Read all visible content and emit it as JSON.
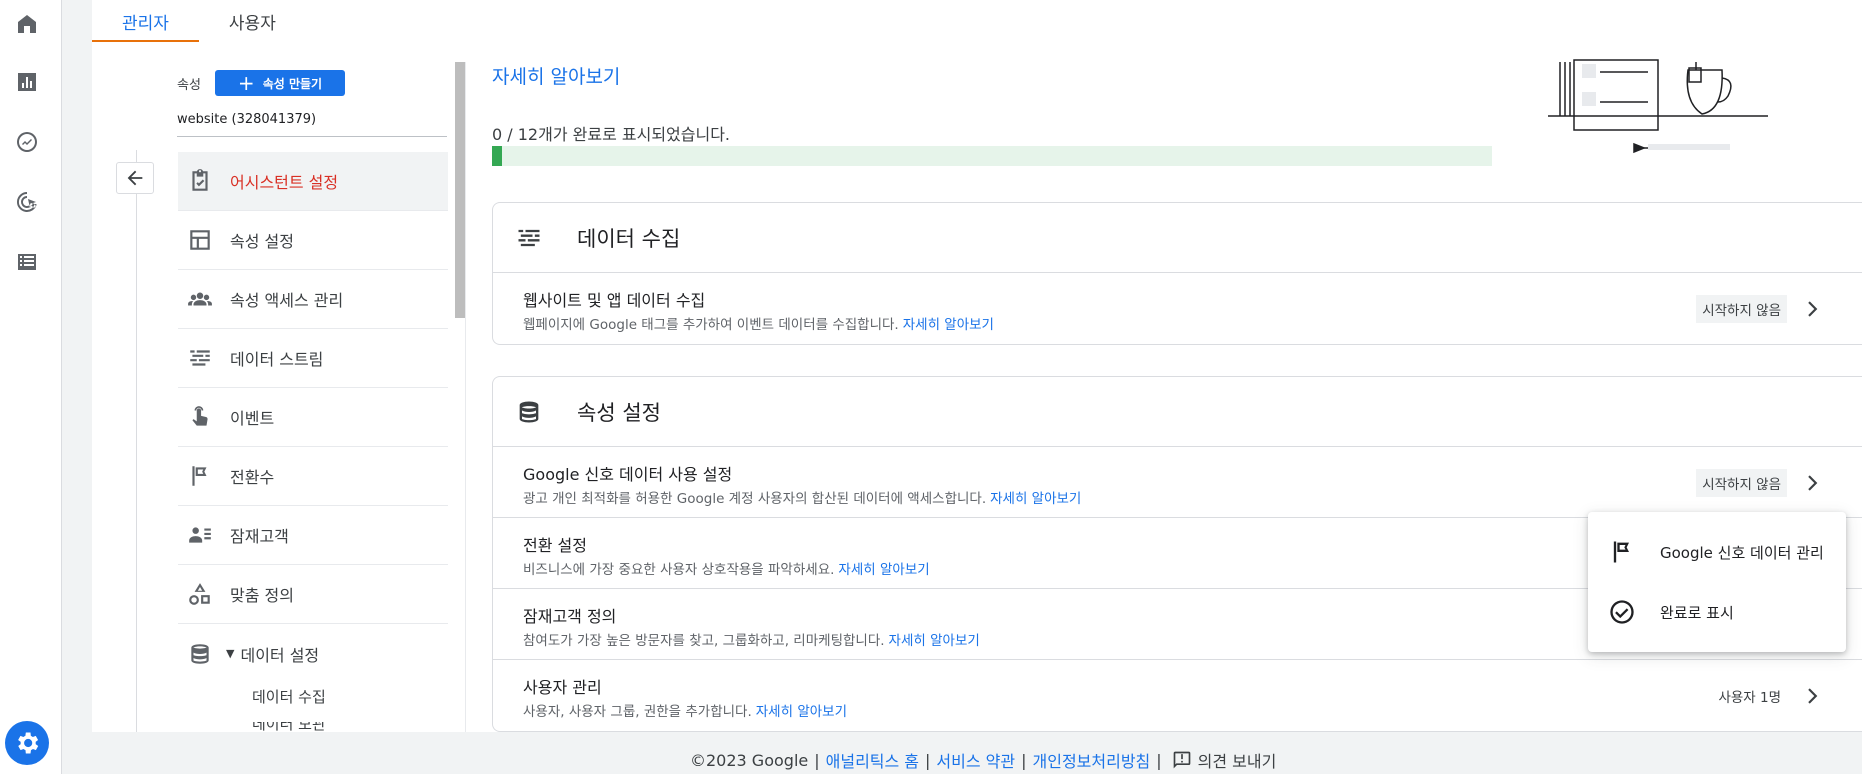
{
  "tabs": [
    {
      "label": "관리자"
    },
    {
      "label": "사용자"
    }
  ],
  "property": {
    "label": "속성",
    "create_label": "속성 만들기",
    "name": "website (328041379)"
  },
  "nav": {
    "items": [
      {
        "label": "어시스턴트 설정",
        "icon": "checklist-icon"
      },
      {
        "label": "속성 설정",
        "icon": "layout-icon"
      },
      {
        "label": "속성 액세스 관리",
        "icon": "people-icon"
      },
      {
        "label": "데이터 스트림",
        "icon": "streams-icon"
      },
      {
        "label": "이벤트",
        "icon": "touch-icon"
      },
      {
        "label": "전환수",
        "icon": "flag-icon"
      },
      {
        "label": "잠재고객",
        "icon": "audience-icon"
      },
      {
        "label": "맞춤 정의",
        "icon": "shapes-icon"
      },
      {
        "label": "데이터 설정",
        "icon": "database-icon"
      }
    ],
    "sub_items": [
      {
        "label": "데이터 수집"
      },
      {
        "label": "데이터 보관"
      }
    ]
  },
  "content": {
    "learn_more_top": "자세히 알아보기",
    "progress_text": "0 / 12개가 완료로 표시되었습니다.",
    "progress_fraction": 0.01
  },
  "cards": [
    {
      "title": "데이터 수집",
      "icon": "streams-icon",
      "rows": [
        {
          "title": "웹사이트 및 앱 데이터 수집",
          "desc": "웹페이지에 Google 태그를 추가하여 이벤트 데이터를 수집합니다.",
          "link": "자세히 알아보기",
          "status": "시작하지 않음"
        }
      ]
    },
    {
      "title": "속성 설정",
      "icon": "database-icon",
      "rows": [
        {
          "title": "Google 신호 데이터 사용 설정",
          "desc": "광고 개인 최적화를 허용한 Google 계정 사용자의 합산된 데이터에 액세스합니다.",
          "link": "자세히 알아보기",
          "status": "시작하지 않음"
        },
        {
          "title": "전환 설정",
          "desc": "비즈니스에 가장 중요한 사용자 상호작용을 파악하세요.",
          "link": "자세히 알아보기",
          "status": ""
        },
        {
          "title": "잠재고객 정의",
          "desc": "참여도가 가장 높은 방문자를 찾고, 그룹화하고, 리마케팅합니다.",
          "link": "자세히 알아보기",
          "status": ""
        },
        {
          "title": "사용자 관리",
          "desc": "사용자, 사용자 그룹, 권한을 추가합니다.",
          "link": "자세히 알아보기",
          "status": "사용자 1명"
        }
      ]
    }
  ],
  "menu": {
    "items": [
      {
        "label": "Google 신호 데이터 관리",
        "icon": "flag-icon"
      },
      {
        "label": "완료로 표시",
        "icon": "check-circle-icon"
      }
    ]
  },
  "footer": {
    "copyright": "©2023 Google",
    "links": [
      "애널리틱스 홈",
      "서비스 약관",
      "개인정보처리방침"
    ],
    "feedback": "의견 보내기"
  },
  "colors": {
    "accent": "#1a73e8",
    "active_nav": "#d93025",
    "progress": "#34a853",
    "tab_indicator": "#e8710a"
  }
}
